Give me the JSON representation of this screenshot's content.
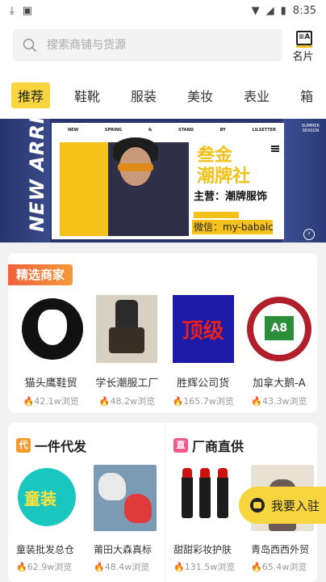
{
  "status": {
    "time": "8:35"
  },
  "header": {
    "search_placeholder": "搜索商铺与货源",
    "card_label": "名片"
  },
  "tabs": [
    "推荐",
    "鞋靴",
    "服装",
    "美妆",
    "表业",
    "箱"
  ],
  "banner": {
    "side_text": "NEW ARRNAL",
    "poster": {
      "top_words": [
        "NEW",
        "SPRING",
        "&",
        "STAND",
        "BY",
        "LILSETTER"
      ],
      "brand_line1": "叁金",
      "brand_line2": "潮牌社",
      "main": "主营：潮牌服饰",
      "wechat": "微信：my-babalcc"
    }
  },
  "featured": {
    "title": "精选商家",
    "shops": [
      {
        "name": "猫头鹰鞋贸",
        "views": "42.1w浏览"
      },
      {
        "name": "学长潮服工厂",
        "views": "48.2w浏览"
      },
      {
        "name": "胜辉公司货",
        "views": "165.7w浏览"
      },
      {
        "name": "加拿大鹅-A",
        "views": "43.3w浏览"
      }
    ],
    "shop_top_text": "顶级",
    "kids_text": "童装"
  },
  "dropship": {
    "title": "一件代发",
    "icon_text": "代",
    "items": [
      {
        "name": "童装批发总仓",
        "views": "62.9w浏览"
      },
      {
        "name": "莆田大森真标",
        "views": "48.4w浏览"
      }
    ]
  },
  "factory": {
    "title": "厂商直供",
    "icon_text": "直",
    "items": [
      {
        "name": "甜甜彩妆护肤",
        "views": "131.5w浏览"
      },
      {
        "name": "青岛西西外贸",
        "views": "65.4w浏览"
      }
    ]
  },
  "join_button": "我要入驻",
  "colors": {
    "accent": "#f6d53f",
    "badge": "#f2603b",
    "fire": "#e33333"
  }
}
